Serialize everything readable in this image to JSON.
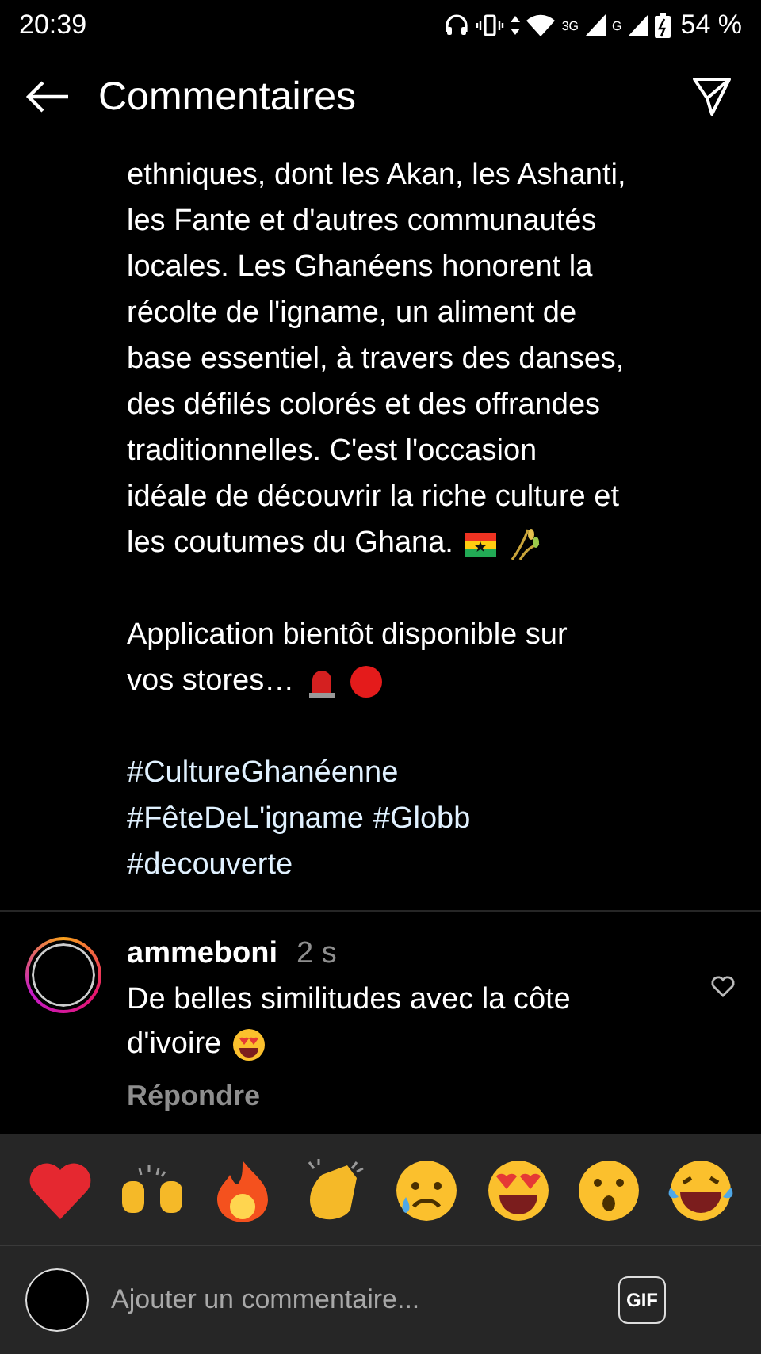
{
  "status_bar": {
    "time": "20:39",
    "network_labels": [
      "3G",
      "G"
    ],
    "battery": "54 %"
  },
  "header": {
    "title": "Commentaires"
  },
  "post": {
    "paragraphs": [
      {
        "lines": [
          "ethniques, dont les Akan, les Ashanti,",
          "les Fante et d'autres communautés",
          "locales. Les Ghanéens honorent la",
          "récolte de l'igname, un aliment de",
          "base essentiel, à travers des danses,",
          "des défilés colorés et des offrandes",
          "traditionnelles. C'est l'occasion",
          "idéale de découvrir la riche culture et",
          "les coutumes du Ghana."
        ],
        "emojis": [
          {
            "kind": "flag"
          },
          {
            "kind": "wheat"
          }
        ]
      },
      {
        "lines": [
          "Application bientôt disponible sur",
          "vos stores…"
        ],
        "emojis": [
          {
            "kind": "siren"
          },
          {
            "kind": "red-circle"
          }
        ]
      }
    ],
    "hashtag_lines": [
      [
        "#CultureGhanéenne"
      ],
      [
        "#FêteDeL'igname",
        "#Globb"
      ],
      [
        "#decouverte"
      ]
    ]
  },
  "comment": {
    "user": "ammeboni",
    "time": "2 s",
    "lines": [
      "De belles similitudes avec la côte",
      "d'ivoire"
    ],
    "emojis": [
      {
        "kind": "heart-eyes"
      }
    ],
    "reply": "Répondre",
    "liked": false
  },
  "reactions": [
    {
      "kind": "heart"
    },
    {
      "kind": "raised-hands"
    },
    {
      "kind": "fire"
    },
    {
      "kind": "clap"
    },
    {
      "kind": "sad"
    },
    {
      "kind": "heart-eyes"
    },
    {
      "kind": "wow"
    },
    {
      "kind": "laugh"
    }
  ],
  "composer": {
    "placeholder": "Ajouter un commentaire...",
    "gif": "GIF"
  }
}
